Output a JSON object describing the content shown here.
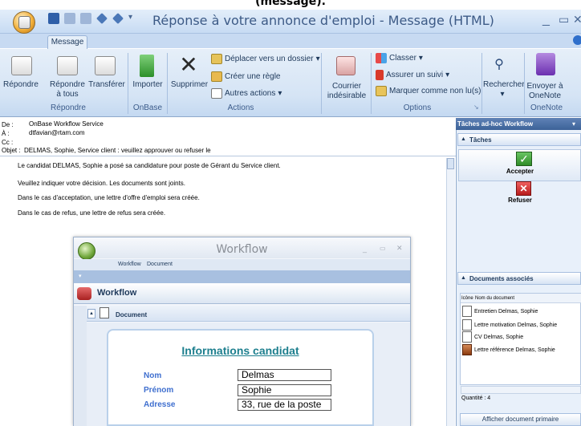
{
  "caption": "(message).",
  "window": {
    "title": "Réponse à votre annonce d'emploi - Message (HTML)",
    "min": "_",
    "max": "▭",
    "close": "✕"
  },
  "tabs": {
    "message": "Message"
  },
  "ribbon": {
    "reply": "Répondre",
    "reply_all_1": "Répondre",
    "reply_all_2": "à tous",
    "forward": "Transférer",
    "import": "Importer",
    "delete": "Supprimer",
    "move_to_folder": "Déplacer vers un dossier",
    "create_rule": "Créer une règle",
    "other_actions": "Autres actions",
    "junk_1": "Courrier",
    "junk_2": "indésirable",
    "classify": "Classer",
    "follow_up": "Assurer un suivi",
    "mark_unread": "Marquer comme non lu(s)",
    "search": "Rechercher",
    "send_onenote_1": "Envoyer à",
    "send_onenote_2": "OneNote",
    "groups": {
      "repondre": "Répondre",
      "onbase": "OnBase",
      "actions": "Actions",
      "options": "Options",
      "onenote": "OneNote"
    }
  },
  "header": {
    "from_label": "De :",
    "from_value": "OnBase Workflow Service",
    "to_label": "À :",
    "to_value": "dtfavian@rtam.com",
    "cc_label": "Cc :",
    "cc_value": "",
    "subject_label": "Objet :",
    "subject_value": "DELMAS, Sophie,  Service client : veuillez approuver ou refuser le"
  },
  "body": {
    "p1": "Le candidat DELMAS, Sophie a posé sa candidature pour poste de Gérant du Service client.",
    "p2": "Veuillez indiquer votre décision. Les documents sont joints.",
    "p3": "Dans le cas d'acceptation, une lettre d'offre d'emploi sera créée.",
    "p4": "Dans le cas de refus, une lettre de refus sera créée."
  },
  "right_pane": {
    "title": "Tâches ad-hoc Workflow",
    "tasks_title": "Tâches",
    "accept": "Accepter",
    "refuse": "Refuser",
    "docs_title": "Documents associés",
    "col_icon": "Icône",
    "col_name": "Nom du document",
    "documents": [
      "Entretien Delmas, Sophie",
      "Lettre motivation Delmas, Sophie",
      "CV Delmas, Sophie",
      "Lettre référence Delmas, Sophie"
    ],
    "quantity": "Quantité : 4",
    "primary_button": "Afficher document primaire"
  },
  "workflow": {
    "title": "Workflow",
    "menu_workflow": "Workflow",
    "menu_document": "Document",
    "header": "Workflow",
    "document_label": "Document",
    "form_title": "Informations candidat",
    "fields": [
      {
        "label": "Nom",
        "value": "Delmas"
      },
      {
        "label": "Prénom",
        "value": "Sophie"
      },
      {
        "label": "Adresse",
        "value": "33, rue de la poste"
      }
    ]
  },
  "colors": {
    "ribbon_blue": "#d5e4f5",
    "accent_teal": "#1d7f8e",
    "label_blue": "#3f6fcf"
  }
}
